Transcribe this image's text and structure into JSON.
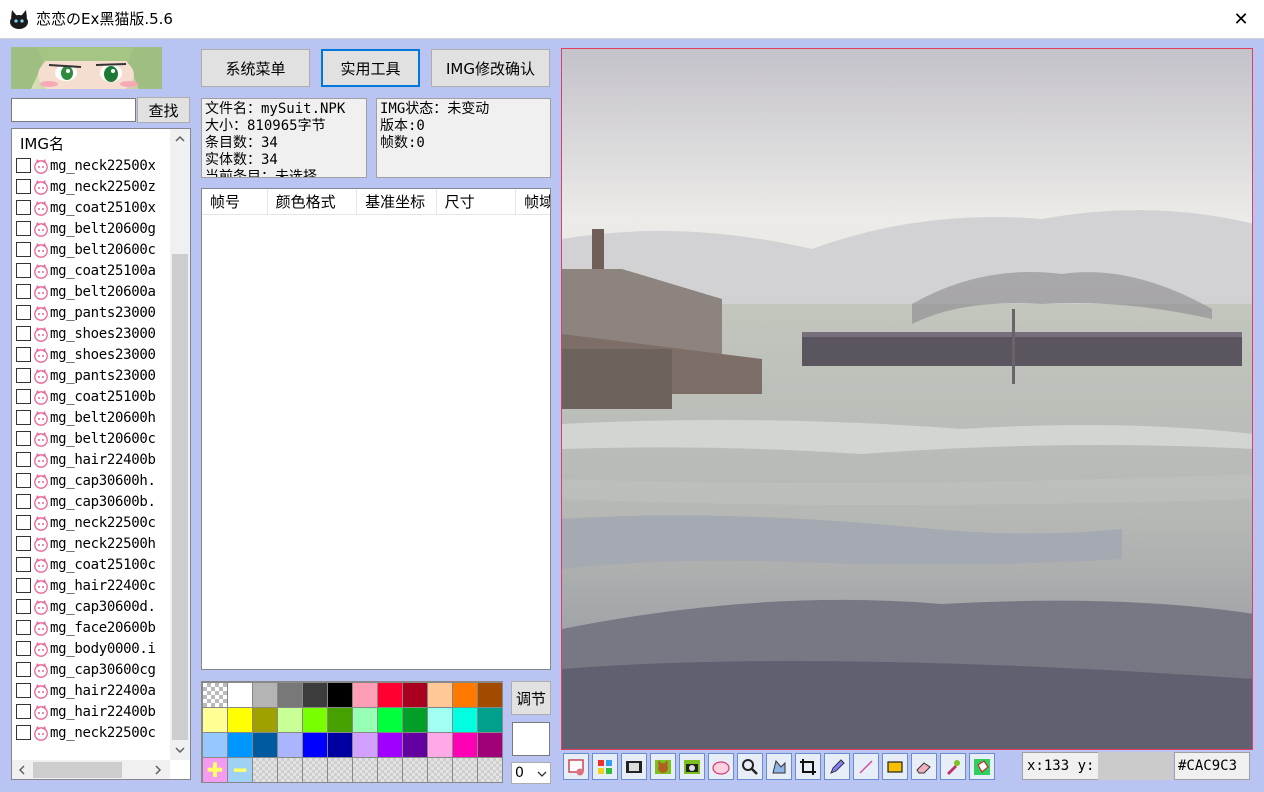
{
  "window": {
    "title": "恋恋のEx黑猫版.5.6",
    "close_symbol": "✕"
  },
  "search": {
    "value": "",
    "button_label": "查找"
  },
  "img_list": {
    "header": "IMG名",
    "items": [
      "mg_neck22500x",
      "mg_neck22500z",
      "mg_coat25100x",
      "mg_belt20600g",
      "mg_belt20600c",
      "mg_coat25100a",
      "mg_belt20600a",
      "mg_pants23000",
      "mg_shoes23000",
      "mg_shoes23000",
      "mg_pants23000",
      "mg_coat25100b",
      "mg_belt20600h",
      "mg_belt20600c",
      "mg_hair22400b",
      "mg_cap30600h.",
      "mg_cap30600b.",
      "mg_neck22500c",
      "mg_neck22500h",
      "mg_coat25100c",
      "mg_hair22400c",
      "mg_cap30600d.",
      "mg_face20600b",
      "mg_body0000.i",
      "mg_cap30600cg",
      "mg_hair22400a",
      "mg_hair22400b",
      "mg_neck22500c"
    ]
  },
  "toolbar_top": {
    "system_menu": "系统菜单",
    "tools": "实用工具",
    "img_confirm": "IMG修改确认"
  },
  "file_info": {
    "filename": "文件名：mySuit.NPK",
    "size": "大小：810965字节",
    "entries": "条目数：34",
    "entities": "实体数：34",
    "current": "当前条目：未选择"
  },
  "img_info": {
    "status": "IMG状态：未变动",
    "version": "版本:0",
    "frames": "帧数:0"
  },
  "frame_table": {
    "columns": [
      "帧号",
      "颜色格式",
      "基准坐标",
      "尺寸",
      "帧域"
    ]
  },
  "palette": {
    "colors": [
      "transparent",
      "#ffffff",
      "#b4b4b4",
      "#787878",
      "#3c3c3c",
      "#000000",
      "#ff9eb5",
      "#ff0030",
      "#a8001e",
      "#ffc896",
      "#ff7800",
      "#a04b00",
      "#ffff96",
      "#ffff00",
      "#a0a000",
      "#c8ff96",
      "#78ff00",
      "#46a000",
      "#96ffb4",
      "#00ff3c",
      "#00a028",
      "#a0fff0",
      "#00ffe0",
      "#00a08c",
      "#96c8ff",
      "#0096ff",
      "#005aa0",
      "#aab4ff",
      "#0000ff",
      "#0000a0",
      "#d2a0ff",
      "#a000ff",
      "#6400a0",
      "#ffaae6",
      "#ff00b4",
      "#a00078"
    ],
    "add_symbol": "✚",
    "remove_symbol": "━"
  },
  "adjust": {
    "button_label": "调节",
    "preview_color": "#ffffff",
    "frame_select_value": "0"
  },
  "status": {
    "coords": "x:133 y:",
    "color_hex": "#CAC9C3"
  },
  "tool_icons": [
    "image-settings-icon",
    "color-palette-icon",
    "film-strip-icon",
    "cat-icon",
    "camera-icon",
    "cloud-icon",
    "zoom-icon",
    "move-icon",
    "crop-icon",
    "pencil-icon",
    "line-icon",
    "rectangle-icon",
    "eraser-icon",
    "dropper-icon",
    "fill-bucket-icon"
  ]
}
